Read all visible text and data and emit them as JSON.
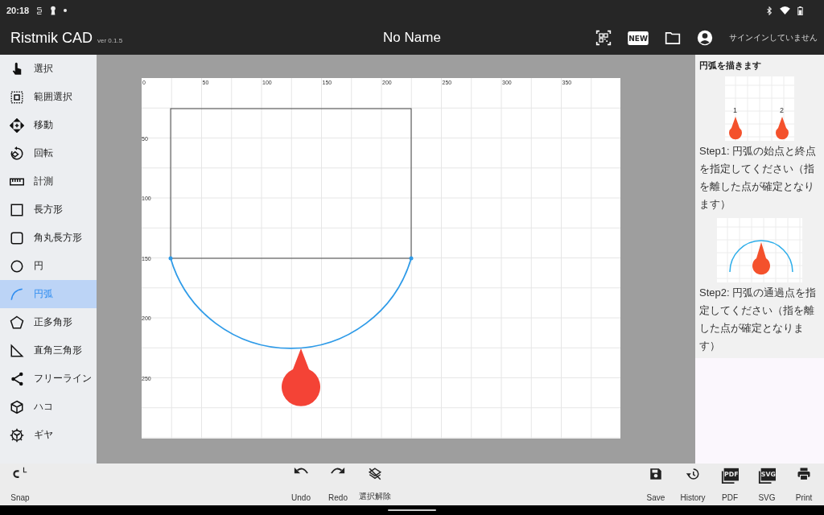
{
  "status_bar": {
    "time": "20:18"
  },
  "app_bar": {
    "title": "Ristmik CAD",
    "version": "ver 0.1.5",
    "document": "No Name",
    "new_icon_text": "NEW",
    "account": "サインインしていません"
  },
  "tools": [
    {
      "label": "選択",
      "selected": false
    },
    {
      "label": "範囲選択",
      "selected": false
    },
    {
      "label": "移動",
      "selected": false
    },
    {
      "label": "回転",
      "selected": false
    },
    {
      "label": "計測",
      "selected": false
    },
    {
      "label": "長方形",
      "selected": false
    },
    {
      "label": "角丸長方形",
      "selected": false
    },
    {
      "label": "円",
      "selected": false
    },
    {
      "label": "円弧",
      "selected": true
    },
    {
      "label": "正多角形",
      "selected": false
    },
    {
      "label": "直角三角形",
      "selected": false
    },
    {
      "label": "フリーライン",
      "selected": false
    },
    {
      "label": "ハコ",
      "selected": false
    },
    {
      "label": "ギヤ",
      "selected": false
    }
  ],
  "canvas": {
    "x_ruler": [
      "0",
      "50",
      "100",
      "150",
      "200",
      "250",
      "300",
      "350"
    ],
    "y_ruler": [
      "50",
      "100",
      "150",
      "200",
      "250"
    ]
  },
  "help": {
    "title": "円弧を描きます",
    "step1_labels": [
      "1",
      "2"
    ],
    "step1": "Step1: 円弧の始点と終点を指定してください（指を離した点が確定となります）",
    "step2": "Step2: 円弧の通過点を指定してください（指を離した点が確定となります）"
  },
  "bottom_toolbar": {
    "left": [
      {
        "kind": "snap",
        "label": "Snap"
      }
    ],
    "center": [
      {
        "kind": "undo",
        "label": "Undo"
      },
      {
        "kind": "redo",
        "label": "Redo"
      },
      {
        "kind": "deselect",
        "label": "選択解除"
      }
    ],
    "right": [
      {
        "kind": "save",
        "label": "Save"
      },
      {
        "kind": "history",
        "label": "History"
      },
      {
        "kind": "pdf",
        "label": "PDF",
        "icon_text": "PDF"
      },
      {
        "kind": "svg",
        "label": "SVG",
        "icon_text": "SVG"
      },
      {
        "kind": "print",
        "label": "Print"
      }
    ]
  }
}
